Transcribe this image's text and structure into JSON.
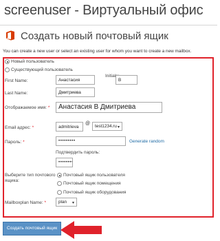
{
  "app": {
    "title": "screenuser - Виртуальный офис"
  },
  "page": {
    "heading": "Создать новый почтовый ящик",
    "intro": "You can create a new user or select an existing user for whom you want to create a new mailbox."
  },
  "user_mode": {
    "new_label": "Новый пользователь",
    "existing_label": "Существующий пользователь",
    "selected": "new"
  },
  "form": {
    "first_name": {
      "label": "First Name:",
      "value": "Анастасия"
    },
    "initials": {
      "label": "Initials:",
      "value": "В"
    },
    "last_name": {
      "label": "Last Name:",
      "value": "Дмитриева"
    },
    "display_name": {
      "label": "Отображаемое имя:",
      "required_mark": "*",
      "value": "Анастасия В Дмитриева"
    },
    "email": {
      "label": "Email адрес:",
      "required_mark": "*",
      "alias": "admitrieva",
      "at": "@",
      "domain": "test1234.ru"
    },
    "password": {
      "label": "Пароль:",
      "required_mark": "*",
      "value": "•••••••••",
      "generate_link": "Generate random"
    },
    "confirm_password": {
      "label": "Подтвердить пароль:",
      "value": "•••••••••"
    },
    "mailbox_type": {
      "label_line1": "Выберите тип почтового",
      "label_line2": "ящика:",
      "options": [
        "Почтовый ящик пользователя",
        "Почтовый ящик помещения",
        "Почтовый ящик оборудования"
      ],
      "selected_index": 0
    },
    "mailbox_plan": {
      "label": "Mailboxplan Name:",
      "required_mark": "*",
      "value": "plan"
    }
  },
  "actions": {
    "create_label": "Создать почтовый ящик"
  },
  "colors": {
    "highlight_red": "#e0222b",
    "button_blue": "#5a92c6",
    "link_blue": "#1f6ba5",
    "office_orange": "#d83b01"
  },
  "icons": {
    "logo": "office-logo-icon",
    "dropdown": "chevron-down-icon",
    "pointer": "red-arrow-icon"
  }
}
